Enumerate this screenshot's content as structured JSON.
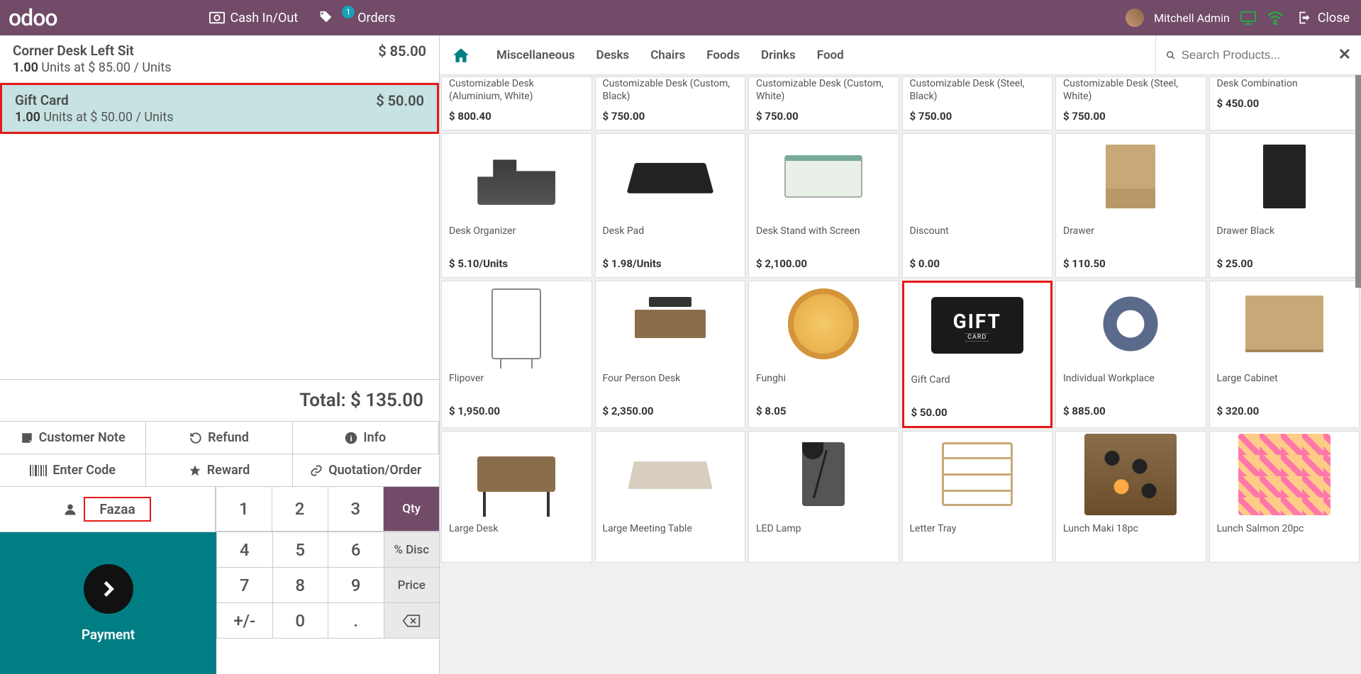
{
  "topbar": {
    "logo": "odoo",
    "cash_label": "Cash In/Out",
    "orders_label": "Orders",
    "orders_badge": "1",
    "user_name": "Mitchell Admin",
    "close_label": "Close"
  },
  "order": {
    "lines": [
      {
        "name": "Corner Desk Left Sit",
        "qty": "1.00",
        "unit_price": "$ 85.00",
        "uom": "Units",
        "price": "$ 85.00",
        "selected": false
      },
      {
        "name": "Gift Card",
        "qty": "1.00",
        "unit_price": "$ 50.00",
        "uom": "Units",
        "price": "$ 50.00",
        "selected": true
      }
    ],
    "total_label": "Total:",
    "total": "$ 135.00"
  },
  "actions": {
    "customer_note": "Customer Note",
    "refund": "Refund",
    "info": "Info",
    "enter_code": "Enter Code",
    "reward": "Reward",
    "quotation": "Quotation/Order",
    "customer": "Fazaa",
    "payment": "Payment"
  },
  "numpad": {
    "keys": [
      "1",
      "2",
      "3",
      "4",
      "5",
      "6",
      "7",
      "8",
      "9",
      "+/-",
      "0",
      "."
    ],
    "qty": "Qty",
    "disc": "% Disc",
    "price": "Price",
    "backspace": "⌫"
  },
  "categories": [
    "Miscellaneous",
    "Desks",
    "Chairs",
    "Foods",
    "Drinks",
    "Food"
  ],
  "search": {
    "placeholder": "Search Products...",
    "clear": "✕"
  },
  "products_row0": [
    {
      "name": "Customizable Desk (Aluminium, White)",
      "price": "$ 800.40"
    },
    {
      "name": "Customizable Desk (Custom, Black)",
      "price": "$ 750.00"
    },
    {
      "name": "Customizable Desk (Custom, White)",
      "price": "$ 750.00"
    },
    {
      "name": "Customizable Desk (Steel, Black)",
      "price": "$ 750.00"
    },
    {
      "name": "Customizable Desk (Steel, White)",
      "price": "$ 750.00"
    },
    {
      "name": "Desk Combination",
      "price": "$ 450.00"
    }
  ],
  "products": [
    {
      "name": "Desk Organizer",
      "price": "$ 5.10/Units",
      "img": "desk-org"
    },
    {
      "name": "Desk Pad",
      "price": "$ 1.98/Units",
      "img": "desk-pad"
    },
    {
      "name": "Desk Stand with Screen",
      "price": "$ 2,100.00",
      "img": "desk-stand"
    },
    {
      "name": "Discount",
      "price": "$ 0.00",
      "img": "none"
    },
    {
      "name": "Drawer",
      "price": "$ 110.50",
      "img": "drawer"
    },
    {
      "name": "Drawer Black",
      "price": "$ 25.00",
      "img": "drawer-black"
    },
    {
      "name": "Flipover",
      "price": "$ 1,950.00",
      "img": "flip"
    },
    {
      "name": "Four Person Desk",
      "price": "$ 2,350.00",
      "img": "four-desk"
    },
    {
      "name": "Funghi",
      "price": "$ 8.05",
      "img": "pizza"
    },
    {
      "name": "Gift Card",
      "price": "$ 50.00",
      "img": "gift",
      "highlight": true
    },
    {
      "name": "Individual Workplace",
      "price": "$ 885.00",
      "img": "workplace"
    },
    {
      "name": "Large Cabinet",
      "price": "$ 320.00",
      "img": "cabinet"
    },
    {
      "name": "Large Desk",
      "price": "",
      "img": "large-desk"
    },
    {
      "name": "Large Meeting Table",
      "price": "",
      "img": "meeting"
    },
    {
      "name": "LED Lamp",
      "price": "",
      "img": "lamp"
    },
    {
      "name": "Letter Tray",
      "price": "",
      "img": "tray"
    },
    {
      "name": "Lunch Maki 18pc",
      "price": "",
      "img": "sushi"
    },
    {
      "name": "Lunch Salmon 20pc",
      "price": "",
      "img": "salmon"
    }
  ]
}
